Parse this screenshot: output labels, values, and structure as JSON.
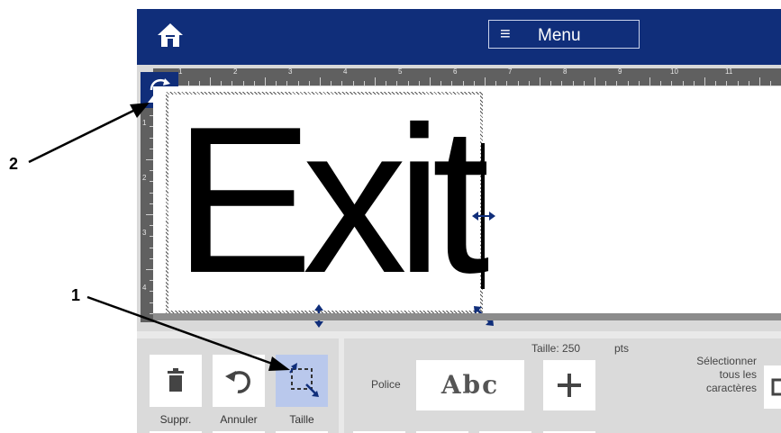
{
  "header": {
    "menu_label": "Menu",
    "menu_icon": "≡"
  },
  "ruler": {
    "top_numbers": [
      "1",
      "2",
      "3",
      "4",
      "5",
      "6",
      "7",
      "8",
      "9",
      "10",
      "11"
    ],
    "left_numbers": [
      "1",
      "2",
      "3",
      "4"
    ]
  },
  "editor": {
    "text": "Exit"
  },
  "toolbar": {
    "delete_label": "Suppr.",
    "undo_label": "Annuler",
    "size_label": "Taille",
    "size_readout": "Taille: 250",
    "size_unit": "pts",
    "font_label": "Police",
    "font_preview": "Abc",
    "select_all_label_1": "Sélectionner",
    "select_all_label_2": "tous les",
    "select_all_label_3": "caractères"
  },
  "callouts": {
    "one": "1",
    "two": "2"
  },
  "colors": {
    "header_bg": "#102e7a",
    "selected_tool_bg": "#b9c8ec",
    "handle_color": "#102e7a"
  },
  "icons": [
    "home-icon",
    "hamburger-icon",
    "rotate-icon",
    "trash-icon",
    "undo-icon",
    "resize-icon",
    "plus-icon",
    "horizontal-resize-icon",
    "vertical-resize-icon",
    "diagonal-resize-icon"
  ]
}
